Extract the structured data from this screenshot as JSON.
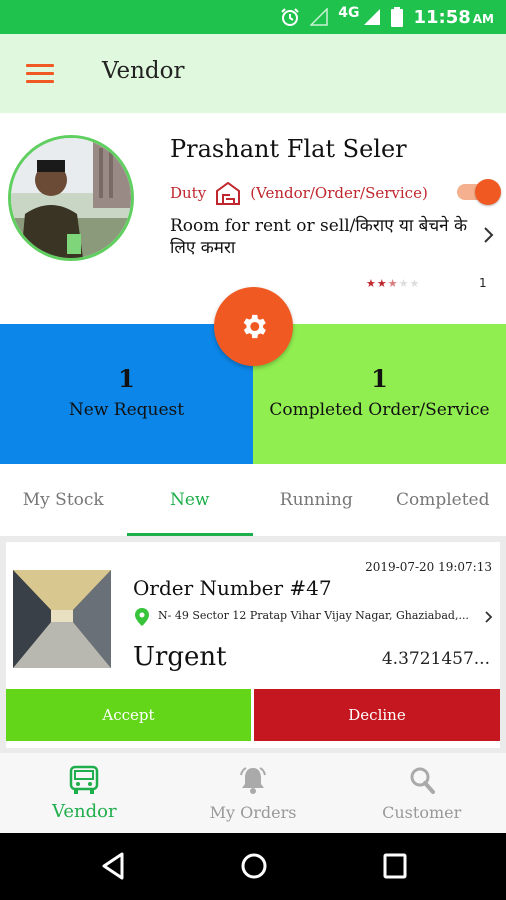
{
  "status_bar": {
    "network": "4G",
    "time": "11:58",
    "ampm": "AM"
  },
  "app_bar": {
    "title": "Vendor"
  },
  "profile": {
    "name": "Prashant Flat Seler",
    "duty_label": "Duty",
    "role": "(Vendor/Order/Service)",
    "duty_on": true,
    "description": "Room for rent or sell/किराए या बेचने के लिए कमरा",
    "rating": 2.5,
    "rating_max": 5,
    "rating_count": "1"
  },
  "stats": {
    "new_request": {
      "count": "1",
      "label": "New Request"
    },
    "completed": {
      "count": "1",
      "label": "Completed Order/Service"
    }
  },
  "tabs": [
    {
      "label": "My Stock"
    },
    {
      "label": "New"
    },
    {
      "label": "Running"
    },
    {
      "label": "Completed"
    }
  ],
  "active_tab": "New",
  "order": {
    "date": "2019-07-20 19:07:13",
    "number": "Order Number #47",
    "address": "N- 49 Sector 12 Pratap Vihar Vijay Nagar, Ghaziabad,...",
    "priority": "Urgent",
    "amount": "4.3721457...",
    "accept_label": "Accept",
    "decline_label": "Decline"
  },
  "bottom_nav": [
    {
      "label": "Vendor"
    },
    {
      "label": "My Orders"
    },
    {
      "label": "Customer"
    }
  ],
  "colors": {
    "status_bar": "#1fc24c",
    "app_bar": "#e0f8dd",
    "accent_orange": "#f05a22",
    "active_green": "#1fae4c",
    "stat_blue": "#0c86e8",
    "stat_green": "#91ee50",
    "accept_green": "#63d61a",
    "decline_red": "#c4171f"
  }
}
